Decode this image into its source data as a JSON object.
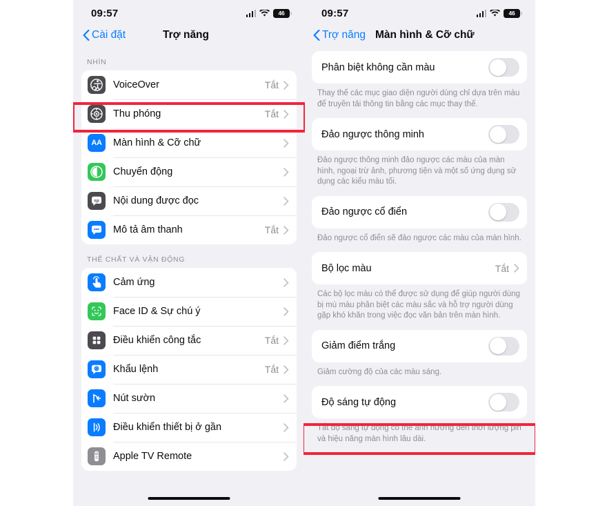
{
  "meta": {
    "accent_blue": "#0a7cff",
    "highlight_red": "#f2243c",
    "background": "#f1f1f5",
    "card": "#ffffff"
  },
  "status_bar": {
    "time": "09:57",
    "battery_level": "46",
    "signal_icon": "cellular-bars-icon",
    "wifi_icon": "wifi-icon",
    "battery_icon": "battery-icon"
  },
  "left_panel": {
    "nav": {
      "back_label": "Cài đặt",
      "title": "Trợ năng",
      "back_icon": "chevron-left-icon"
    },
    "sections": [
      {
        "header": "NHÌN",
        "items": [
          {
            "label": "VoiceOver",
            "value": "Tắt",
            "icon": "voiceover-icon",
            "icon_bg": "#4a4a4f",
            "glyph": "accessibility"
          },
          {
            "label": "Thu phóng",
            "value": "Tắt",
            "icon": "zoom-icon",
            "icon_bg": "#4a4a4f",
            "glyph": "zoom"
          },
          {
            "label": "Màn hình & Cỡ chữ",
            "value": "",
            "icon": "display-text-size-icon",
            "icon_bg": "#0a7cff",
            "glyph": "AA",
            "highlighted": true
          },
          {
            "label": "Chuyển động",
            "value": "",
            "icon": "motion-icon",
            "icon_bg": "#34c759",
            "glyph": "motion"
          },
          {
            "label": "Nội dung được đọc",
            "value": "",
            "icon": "spoken-content-icon",
            "icon_bg": "#4a4a4f",
            "glyph": "speech"
          },
          {
            "label": "Mô tả âm thanh",
            "value": "Tắt",
            "icon": "audio-description-icon",
            "icon_bg": "#0a7cff",
            "glyph": "speech"
          }
        ]
      },
      {
        "header": "THỂ CHẤT VÀ VẬN ĐỘNG",
        "items": [
          {
            "label": "Cảm ứng",
            "value": "",
            "icon": "touch-icon",
            "icon_bg": "#0a7cff",
            "glyph": "touch"
          },
          {
            "label": "Face ID & Sự chú ý",
            "value": "",
            "icon": "face-id-icon",
            "icon_bg": "#34c759",
            "glyph": "face"
          },
          {
            "label": "Điều khiển công tắc",
            "value": "Tắt",
            "icon": "switch-control-icon",
            "icon_bg": "#4a4a4f",
            "glyph": "grid"
          },
          {
            "label": "Khẩu lệnh",
            "value": "Tắt",
            "icon": "voice-control-icon",
            "icon_bg": "#0a7cff",
            "glyph": "voicebubble"
          },
          {
            "label": "Nút sườn",
            "value": "",
            "icon": "side-button-icon",
            "icon_bg": "#0a7cff",
            "glyph": "sidebutton"
          },
          {
            "label": "Điều khiển thiết bị ở gần",
            "value": "",
            "icon": "nearby-device-icon",
            "icon_bg": "#0a7cff",
            "glyph": "waves"
          },
          {
            "label": "Apple TV Remote",
            "value": "",
            "icon": "apple-tv-remote-icon",
            "icon_bg": "#8e8e93",
            "glyph": "remote"
          }
        ]
      }
    ]
  },
  "right_panel": {
    "nav": {
      "back_label": "Trợ năng",
      "title": "Màn hình & Cỡ chữ",
      "back_icon": "chevron-left-icon"
    },
    "groups": [
      {
        "type": "toggle",
        "label": "Phân biệt không cần màu",
        "state": "off",
        "footnote": "Thay thế các mục giao diện người dùng chỉ dựa trên màu để truyền tải thông tin bằng các mục thay thế."
      },
      {
        "type": "toggle",
        "label": "Đảo ngược thông minh",
        "state": "off",
        "footnote": "Đảo ngược thông minh đảo ngược các màu của màn hình, ngoại trừ ảnh, phương tiện và một số ứng dụng sử dụng các kiểu màu tối."
      },
      {
        "type": "toggle",
        "label": "Đảo ngược cổ điển",
        "state": "off",
        "footnote": "Đảo ngược cổ điển sẽ đảo ngược các màu của màn hình."
      },
      {
        "type": "link",
        "label": "Bộ lọc màu",
        "value": "Tắt",
        "footnote": "Các bộ lọc màu có thể được sử dụng để giúp người dùng bị mù màu phân biệt các màu sắc và hỗ trợ người dùng gặp khó khăn trong việc đọc văn bản trên màn hình."
      },
      {
        "type": "toggle",
        "label": "Giảm điểm trắng",
        "state": "off",
        "footnote": "Giảm cường độ của các màu sáng."
      },
      {
        "type": "toggle",
        "label": "Độ sáng tự động",
        "state": "off",
        "highlighted": true,
        "footnote": "Tắt độ sáng tự động có thể ảnh hưởng đến thời lượng pin và hiệu năng màn hình lâu dài."
      }
    ]
  }
}
